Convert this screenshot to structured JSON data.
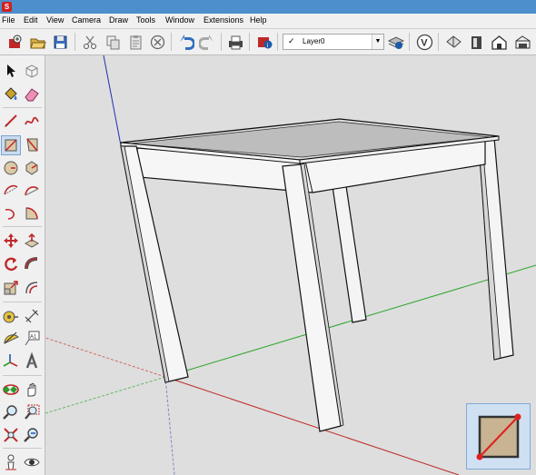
{
  "app": {
    "icon": "sketchup-logo-icon"
  },
  "menu": [
    "File",
    "Edit",
    "View",
    "Camera",
    "Draw",
    "Tools",
    "Window",
    "Extensions",
    "Help"
  ],
  "toolbar": {
    "layer_check": "✓",
    "layer_name": "Layer0",
    "icons": [
      "new-model-icon",
      "open-icon",
      "save-icon",
      "cut-icon",
      "copy-icon",
      "paste-icon",
      "erase-icon",
      "undo-icon",
      "redo-icon",
      "print-icon",
      "model-info-icon",
      "layer-select",
      "layer-manager-icon",
      "3d-warehouse-icon",
      "get-models-icon",
      "share-model-icon",
      "extension-warehouse-icon",
      "component-icon"
    ]
  },
  "left_toolbar": {
    "tools": [
      "select-icon",
      "make-component-icon",
      "paint-bucket-icon",
      "eraser-icon",
      "line-icon",
      "freehand-icon",
      "rectangle-icon",
      "rotated-rectangle-icon",
      "circle-icon",
      "polygon-icon",
      "arc-icon",
      "two-point-arc-icon",
      "three-point-arc-icon",
      "pie-icon",
      "move-icon",
      "push-pull-icon",
      "rotate-icon",
      "follow-me-icon",
      "scale-icon",
      "offset-icon",
      "tape-measure-icon",
      "dimension-icon",
      "protractor-icon",
      "text-icon",
      "axes-icon",
      "3d-text-icon",
      "orbit-icon",
      "pan-icon",
      "zoom-icon",
      "zoom-window-icon",
      "zoom-extents-icon",
      "previous-view-icon",
      "position-camera-icon",
      "look-around-icon"
    ],
    "active_tool": "rectangle-icon"
  },
  "preview": {
    "icon": "rectangle-tool-preview-icon"
  }
}
